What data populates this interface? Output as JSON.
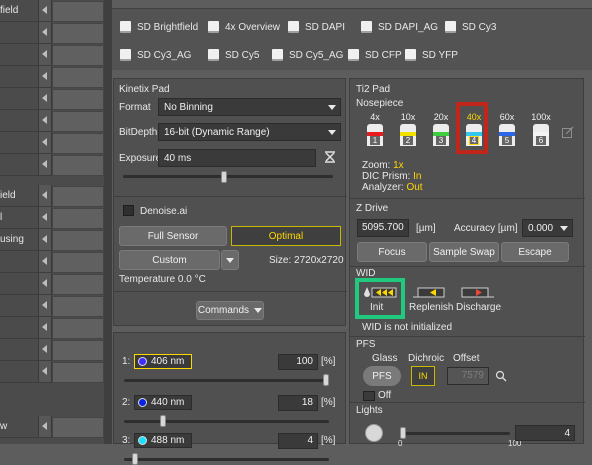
{
  "left_strip": {
    "rows": [
      {
        "text": "field"
      },
      {
        "text": ""
      },
      {
        "text": ""
      },
      {
        "text": ""
      },
      {
        "text": ""
      },
      {
        "text": ""
      },
      {
        "text": ""
      },
      {
        "text": ""
      },
      {
        "text": "ield"
      },
      {
        "text": "l"
      },
      {
        "text": "using"
      },
      {
        "text": ""
      },
      {
        "text": ""
      },
      {
        "text": ""
      },
      {
        "text": ""
      },
      {
        "text": ""
      },
      {
        "text": ""
      },
      {
        "text": "w"
      }
    ]
  },
  "presets": [
    "SD Brightfield",
    "4x Overview",
    "SD DAPI",
    "SD DAPI_AG",
    "SD Cy3",
    "SD Cy3_AG",
    "SD Cy5",
    "SD Cy5_AG",
    "SD CFP",
    "SD YFP"
  ],
  "kinetix": {
    "title": "Kinetix Pad",
    "format_label": "Format",
    "format_value": "No Binning",
    "bitdepth_label": "BitDepth",
    "bitdepth_value": "16-bit (Dynamic Range)",
    "exposure_label": "Exposure",
    "exposure_value": "40 ms",
    "exposure_slider": 0.48,
    "denoise_label": "Denoise.ai",
    "full_sensor": "Full Sensor",
    "optimal": "Optimal",
    "custom": "Custom",
    "size_text": "Size: 2720x2720",
    "temperature": "Temperature 0.0 °C",
    "commands": "Commands"
  },
  "lasers": [
    {
      "label": "1:",
      "wavelength": "406 nm",
      "value": "100",
      "unit": "[%]",
      "color": "#3d2dff",
      "level": 1.0,
      "selected": true
    },
    {
      "label": "2:",
      "wavelength": "440 nm",
      "value": "18",
      "unit": "[%]",
      "color": "#0a22e6",
      "level": 0.18,
      "selected": false
    },
    {
      "label": "3:",
      "wavelength": "488 nm",
      "value": "4",
      "unit": "[%]",
      "color": "#19e0ff",
      "level": 0.04,
      "selected": false
    }
  ],
  "ti2": {
    "title": "Ti2 Pad",
    "nosepiece_label": "Nosepiece",
    "objectives": [
      {
        "mag": "4x",
        "num": "1",
        "color": "#e81c1c",
        "selected": false
      },
      {
        "mag": "10x",
        "num": "2",
        "color": "#f2e200",
        "selected": false
      },
      {
        "mag": "20x",
        "num": "3",
        "color": "#3ecf3e",
        "selected": false
      },
      {
        "mag": "40x",
        "num": "4",
        "color": "#35c6f0",
        "selected": true
      },
      {
        "mag": "60x",
        "num": "5",
        "color": "#2b67e8",
        "selected": false
      },
      {
        "mag": "100x",
        "num": "6",
        "color": "#f4f4f4",
        "selected": false
      }
    ],
    "zoom_label": "Zoom:",
    "zoom_value": "1x",
    "dic_label": "DIC Prism:",
    "dic_value": "In",
    "analyzer_label": "Analyzer:",
    "analyzer_value": "Out",
    "zdrive_label": "Z Drive",
    "z_value": "5095.700",
    "z_unit": "[µm]",
    "accuracy_label": "Accuracy [µm]",
    "accuracy_value": "0.000",
    "focus": "Focus",
    "sample_swap": "Sample Swap",
    "escape": "Escape",
    "wid_label": "WID",
    "init": "Init",
    "replenish": "Replenish",
    "discharge": "Discharge",
    "wid_status": "WID is not initialized",
    "pfs_label": "PFS",
    "glass_label": "Glass",
    "dichroic_label": "Dichroic",
    "offset_label": "Offset",
    "pfs_button": "PFS",
    "dichroic_value": "IN",
    "offset_value": "7579",
    "off_label": "Off",
    "lights_label": "Lights",
    "lights_value": "4",
    "lights_ticks": [
      "0",
      "100"
    ]
  },
  "colors": {
    "highlight_red": "#c0261c",
    "highlight_green": "#20c97e",
    "accent_yellow": "#ffd700"
  }
}
